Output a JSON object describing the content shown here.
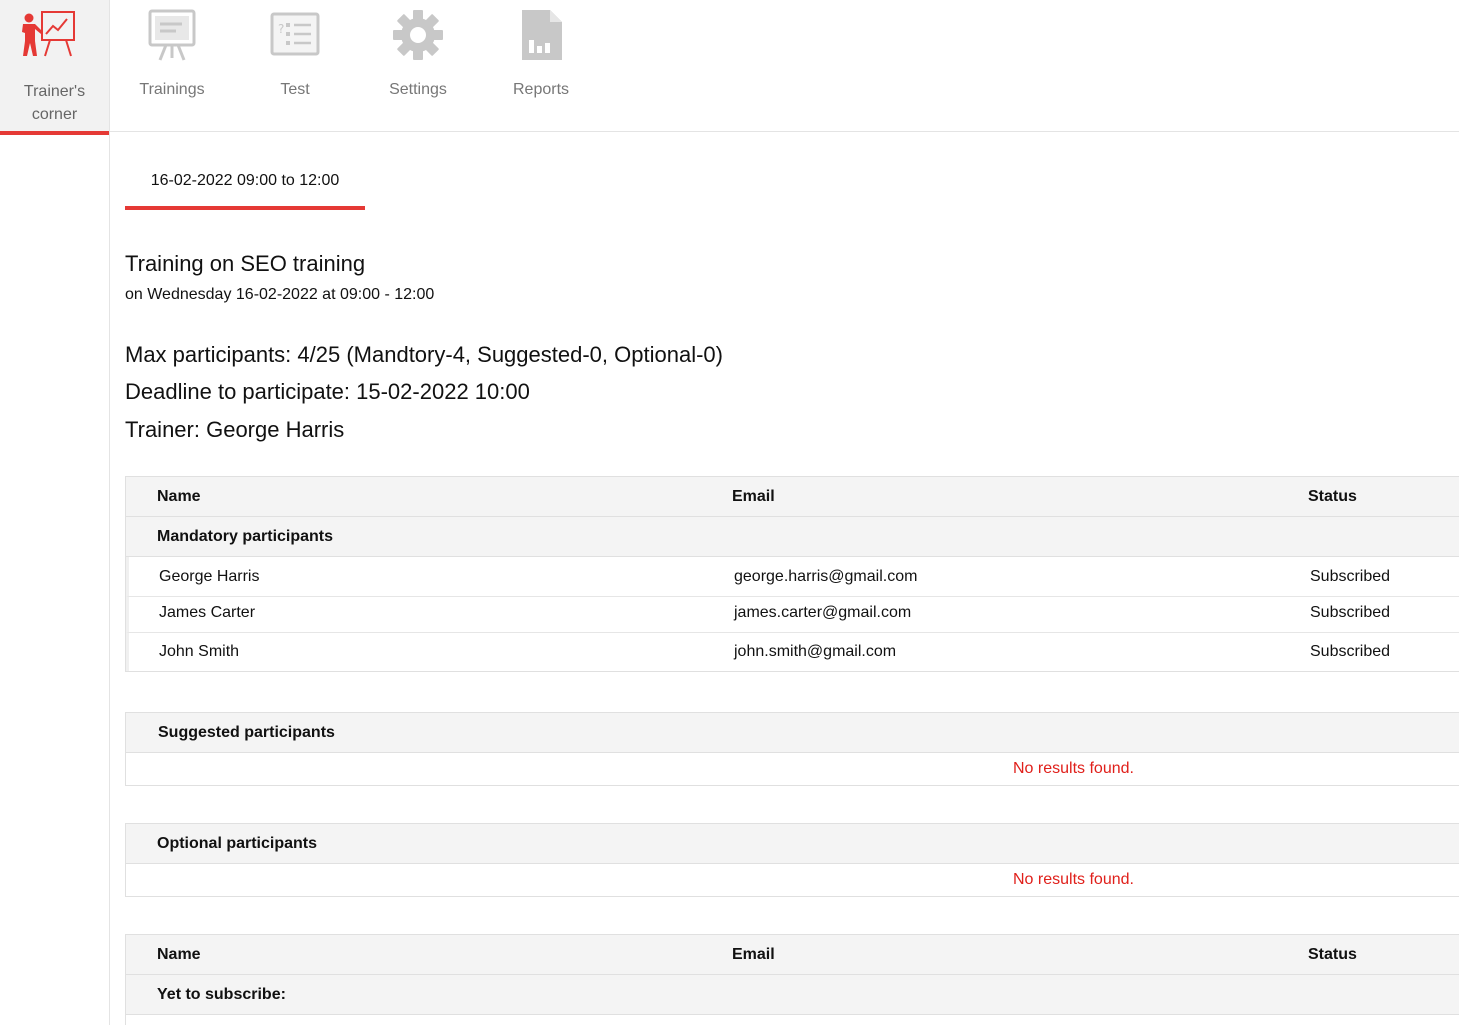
{
  "sidebar": {
    "items": [
      {
        "label": "Trainer's\ncorner",
        "icon": "trainer-presentation-icon",
        "active": true
      }
    ]
  },
  "topnav": {
    "items": [
      {
        "label": "Trainings",
        "icon": "trainings-board-icon"
      },
      {
        "label": "Test",
        "icon": "test-checklist-icon"
      },
      {
        "label": "Settings",
        "icon": "gear-icon"
      },
      {
        "label": "Reports",
        "icon": "report-document-icon"
      }
    ]
  },
  "session_tab": {
    "label": "16-02-2022 09:00 to 12:00"
  },
  "training": {
    "title": "Training on SEO training",
    "when": "on Wednesday 16-02-2022 at 09:00 - 12:00",
    "max_participants": "Max participants: 4/25 (Mandtory-4, Suggested-0, Optional-0)",
    "deadline": "Deadline to participate: 15-02-2022 10:00",
    "trainer": "Trainer: George Harris"
  },
  "columns": {
    "name": "Name",
    "email": "Email",
    "status": "Status"
  },
  "mandatory": {
    "label": "Mandatory participants",
    "rows": [
      {
        "name": "George Harris",
        "email": "george.harris@gmail.com",
        "status": "Subscribed"
      },
      {
        "name": "James Carter",
        "email": "james.carter@gmail.com",
        "status": "Subscribed"
      },
      {
        "name": "John Smith",
        "email": "john.smith@gmail.com",
        "status": "Subscribed"
      }
    ]
  },
  "suggested": {
    "label": "Suggested participants",
    "empty": "No results found."
  },
  "optional": {
    "label": "Optional participants",
    "empty": "No results found."
  },
  "yet_to_subscribe": {
    "label": "Yet to subscribe:"
  },
  "colors": {
    "accent": "#e53935",
    "error": "#e0201b",
    "icon_gray": "#c8c8c8",
    "header_bg": "#f4f4f4"
  }
}
